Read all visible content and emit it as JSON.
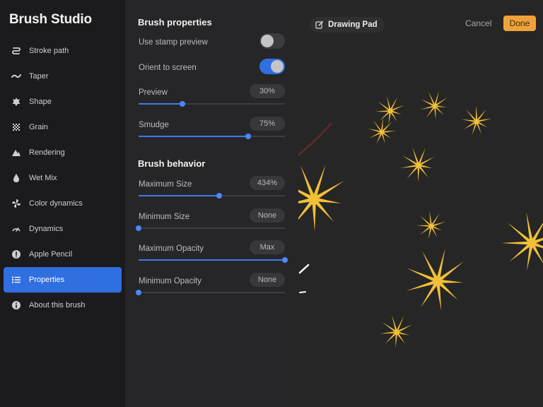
{
  "sidebar": {
    "title": "Brush Studio",
    "items": [
      {
        "label": "Stroke path",
        "icon": "stroke-path-icon"
      },
      {
        "label": "Taper",
        "icon": "taper-icon"
      },
      {
        "label": "Shape",
        "icon": "shape-icon"
      },
      {
        "label": "Grain",
        "icon": "grain-icon"
      },
      {
        "label": "Rendering",
        "icon": "rendering-icon"
      },
      {
        "label": "Wet Mix",
        "icon": "wet-mix-icon"
      },
      {
        "label": "Color dynamics",
        "icon": "color-dynamics-icon"
      },
      {
        "label": "Dynamics",
        "icon": "dynamics-icon"
      },
      {
        "label": "Apple Pencil",
        "icon": "apple-pencil-icon"
      },
      {
        "label": "Properties",
        "icon": "properties-icon",
        "active": true
      },
      {
        "label": "About this brush",
        "icon": "info-icon"
      }
    ]
  },
  "brush_properties": {
    "title": "Brush properties",
    "use_stamp_preview": {
      "label": "Use stamp preview",
      "on": false
    },
    "orient_to_screen": {
      "label": "Orient to screen",
      "on": true
    },
    "preview": {
      "label": "Preview",
      "value": "30%",
      "fraction": 0.3
    },
    "smudge": {
      "label": "Smudge",
      "value": "75%",
      "fraction": 0.75
    }
  },
  "brush_behavior": {
    "title": "Brush behavior",
    "maximum_size": {
      "label": "Maximum Size",
      "value": "434%",
      "fraction": 0.55
    },
    "minimum_size": {
      "label": "Minimum Size",
      "value": "None",
      "fraction": 0.0
    },
    "maximum_opacity": {
      "label": "Maximum Opacity",
      "value": "Max",
      "fraction": 1.0
    },
    "minimum_opacity": {
      "label": "Minimum Opacity",
      "value": "None",
      "fraction": 0.0
    }
  },
  "canvas": {
    "pad_label": "Drawing Pad",
    "pad_icon": "edit-icon",
    "cancel_label": "Cancel",
    "done_label": "Done",
    "star_color": "#f2c037",
    "accent_color": "#2f6fe0",
    "done_color": "#f0a23a"
  }
}
